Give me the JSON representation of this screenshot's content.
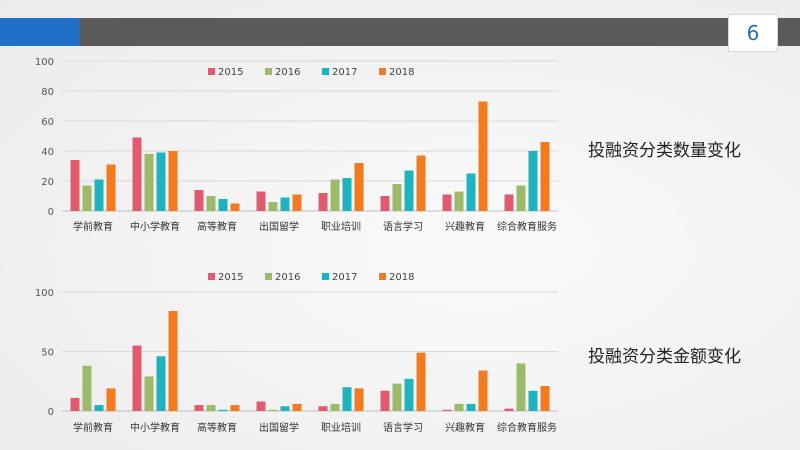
{
  "page_number": "6",
  "labels": {
    "count": "投融资分类数量变化",
    "amount": "投融资分类金额变化"
  },
  "colors": {
    "2015": "#e05a70",
    "2016": "#9dba6a",
    "2017": "#1fb3bf",
    "2018": "#f47a1f",
    "header": "#5a5a5a",
    "accent": "#1f6fc5"
  },
  "chart_data": [
    {
      "type": "bar",
      "categories": [
        "学前教育",
        "中小学教育",
        "高等教育",
        "出国留学",
        "职业培训",
        "语言学习",
        "兴趣教育",
        "综合教育服务"
      ],
      "series": [
        {
          "name": "2015",
          "values": [
            34,
            49,
            14,
            13,
            12,
            10,
            11,
            11
          ]
        },
        {
          "name": "2016",
          "values": [
            17,
            38,
            10,
            6,
            21,
            18,
            13,
            17
          ]
        },
        {
          "name": "2017",
          "values": [
            21,
            39,
            8,
            9,
            22,
            27,
            25,
            40
          ]
        },
        {
          "name": "2018",
          "values": [
            31,
            40,
            5,
            11,
            32,
            37,
            73,
            46
          ]
        }
      ],
      "ylim": [
        0,
        100
      ],
      "yticks": [
        0,
        20,
        40,
        60,
        80,
        100
      ],
      "grid": true,
      "legend": "top"
    },
    {
      "type": "bar",
      "categories": [
        "学前教育",
        "中小学教育",
        "高等教育",
        "出国留学",
        "职业培训",
        "语言学习",
        "兴趣教育",
        "综合教育服务"
      ],
      "series": [
        {
          "name": "2015",
          "values": [
            11,
            55,
            5,
            8,
            4,
            17,
            1,
            2
          ]
        },
        {
          "name": "2016",
          "values": [
            38,
            29,
            5,
            1,
            6,
            23,
            6,
            40
          ]
        },
        {
          "name": "2017",
          "values": [
            5,
            46,
            1,
            4,
            20,
            27,
            6,
            17
          ]
        },
        {
          "name": "2018",
          "values": [
            19,
            84,
            5,
            6,
            19,
            49,
            34,
            21
          ]
        }
      ],
      "ylim": [
        0,
        100
      ],
      "yticks": [
        0,
        50,
        100
      ],
      "grid": true,
      "legend": "top"
    }
  ]
}
